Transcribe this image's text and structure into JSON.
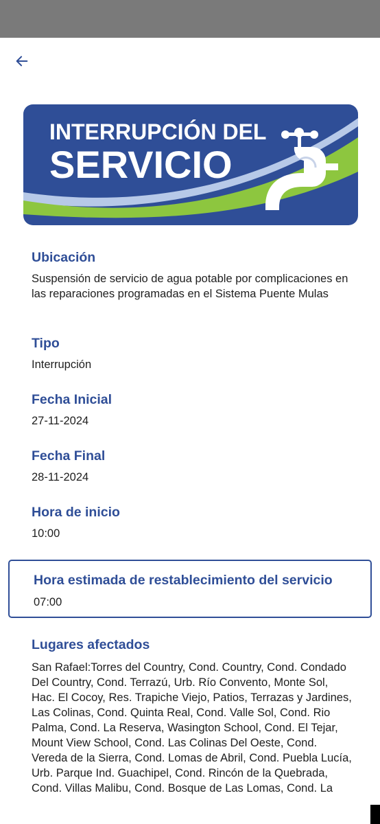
{
  "banner": {
    "line1": "INTERRUPCIÓN DEL",
    "line2": "SERVICIO",
    "colors": {
      "navy": "#2f4e97",
      "green": "#8dc63f",
      "light_blue": "#b7c9e8"
    }
  },
  "fields": {
    "ubicacion": {
      "label": "Ubicación",
      "value": "Suspensión de servicio de agua potable por complicaciones en las reparaciones programadas en el Sistema Puente Mulas"
    },
    "tipo": {
      "label": "Tipo",
      "value": "Interrupción"
    },
    "fecha_inicial": {
      "label": "Fecha Inicial",
      "value": "27-11-2024"
    },
    "fecha_final": {
      "label": "Fecha Final",
      "value": "28-11-2024"
    },
    "hora_inicio": {
      "label": "Hora de inicio",
      "value": "10:00"
    },
    "hora_restablecimiento": {
      "label": "Hora estimada de restablecimiento del servicio",
      "value": "07:00"
    },
    "lugares": {
      "label": "Lugares afectados",
      "value": "San Rafael:Torres del Country, Cond. Country, Cond. Condado Del Country, Cond. Terrazú, Urb. Río Convento, Monte Sol, Hac. El Cocoy, Res. Trapiche Viejo, Patios, Terrazas y Jardines, Las Colinas, Cond. Quinta Real, Cond. Valle Sol, Cond. Rio Palma, Cond. La Reserva, Wasington School, Cond. El Tejar, Mount View School, Cond. Las Colinas Del Oeste, Cond. Vereda de la Sierra, Cond. Lomas de Abril, Cond. Puebla Lucía, Urb. Parque Ind. Guachipel, Cond. Rincón de la Quebrada, Cond. Villas Malibu, Cond. Bosque de Las Lomas, Cond. La"
    }
  },
  "colors": {
    "accent": "#2f4e97",
    "text": "#1e1e1e",
    "status_bar": "#7a7a7a"
  }
}
